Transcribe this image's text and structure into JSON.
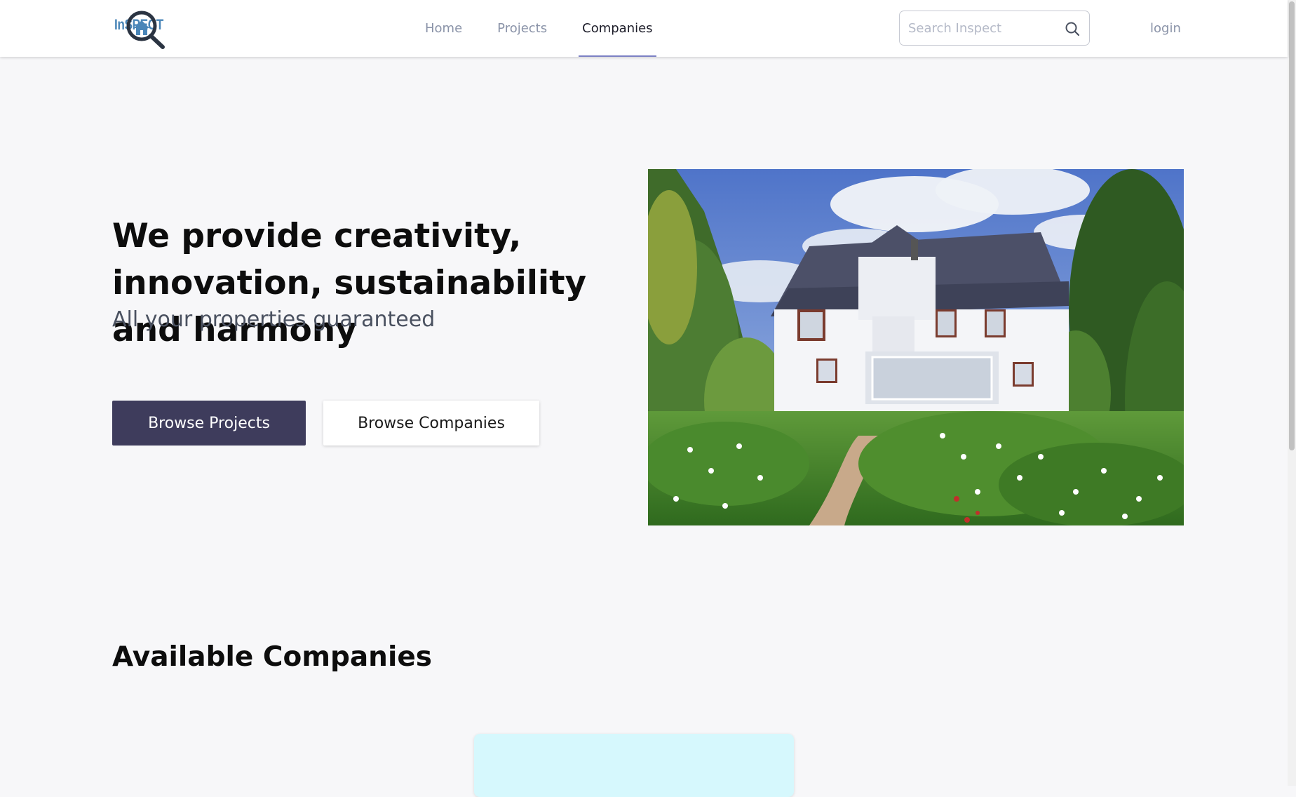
{
  "brand": {
    "logo_text": "InSPECT"
  },
  "nav": {
    "links": [
      {
        "label": "Home",
        "active": false
      },
      {
        "label": "Projects",
        "active": false
      },
      {
        "label": "Companies",
        "active": true
      }
    ]
  },
  "search": {
    "placeholder": "Search Inspect",
    "value": ""
  },
  "auth": {
    "login_label": "login"
  },
  "hero": {
    "title": "We provide creativity, innovation, sustainability and harmony",
    "subtitle": "All your properties guaranteed",
    "primary_button": "Browse Projects",
    "secondary_button": "Browse Companies",
    "image_icon": "house-photo"
  },
  "companies_section": {
    "title": "Available Companies"
  },
  "colors": {
    "primary_button_bg": "#3e3c5c",
    "nav_active_underline": "#7b80c4",
    "logo_blue": "#4a86b8",
    "card_bg": "#d6f8fd",
    "page_bg": "#f7f7f9"
  }
}
